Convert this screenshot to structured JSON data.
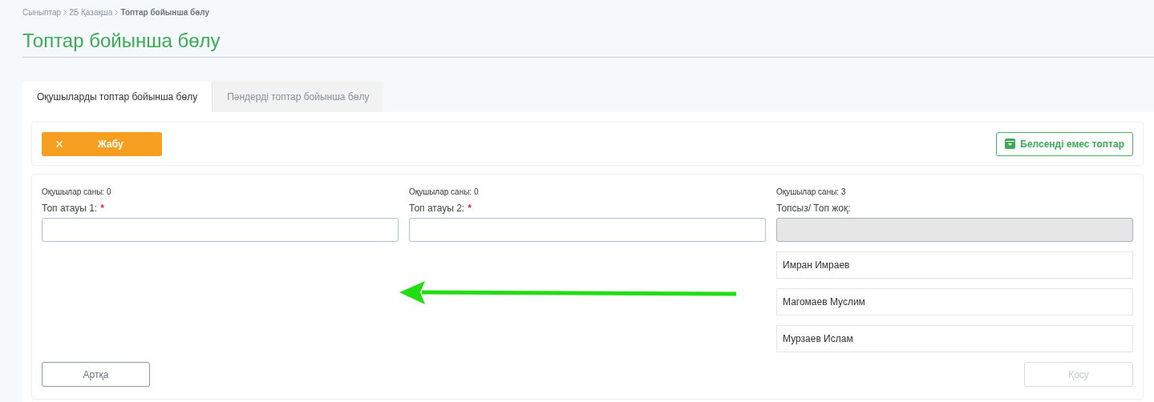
{
  "breadcrumb": [
    {
      "label": "Сыныптар",
      "current": false
    },
    {
      "label": "2Б Қазақша",
      "current": false
    },
    {
      "label": "Топтар бойынша бөлу",
      "current": true
    }
  ],
  "title": "Топтар бойынша бөлу",
  "tabs": [
    {
      "label": "Оқушыларды топтар бойынша бөлу",
      "selected": true
    },
    {
      "label": "Пәндерді топтар бойынша бөлу",
      "selected": false
    }
  ],
  "close_button": {
    "icon": "×",
    "label": "Жабу"
  },
  "inactive_groups_button": "Белсенді емес топтар",
  "columns": [
    {
      "count": "Оқушылар саны: 0",
      "label": "Топ атауы 1:",
      "required_mark": "*",
      "disabled": false
    },
    {
      "count": "Оқушылар саны: 0",
      "label": "Топ атауы 2:",
      "required_mark": "*",
      "disabled": false
    },
    {
      "count": "Оқушылар саны: 3",
      "label": "Топсыз/ Топ жоқ:",
      "disabled": true,
      "students": [
        "Имран Имраев",
        "Магомаев Муслим",
        "Мурзаев Ислам"
      ]
    }
  ],
  "back_button": "Артқа",
  "add_button": {
    "label": "Қосу",
    "disabled": true
  }
}
